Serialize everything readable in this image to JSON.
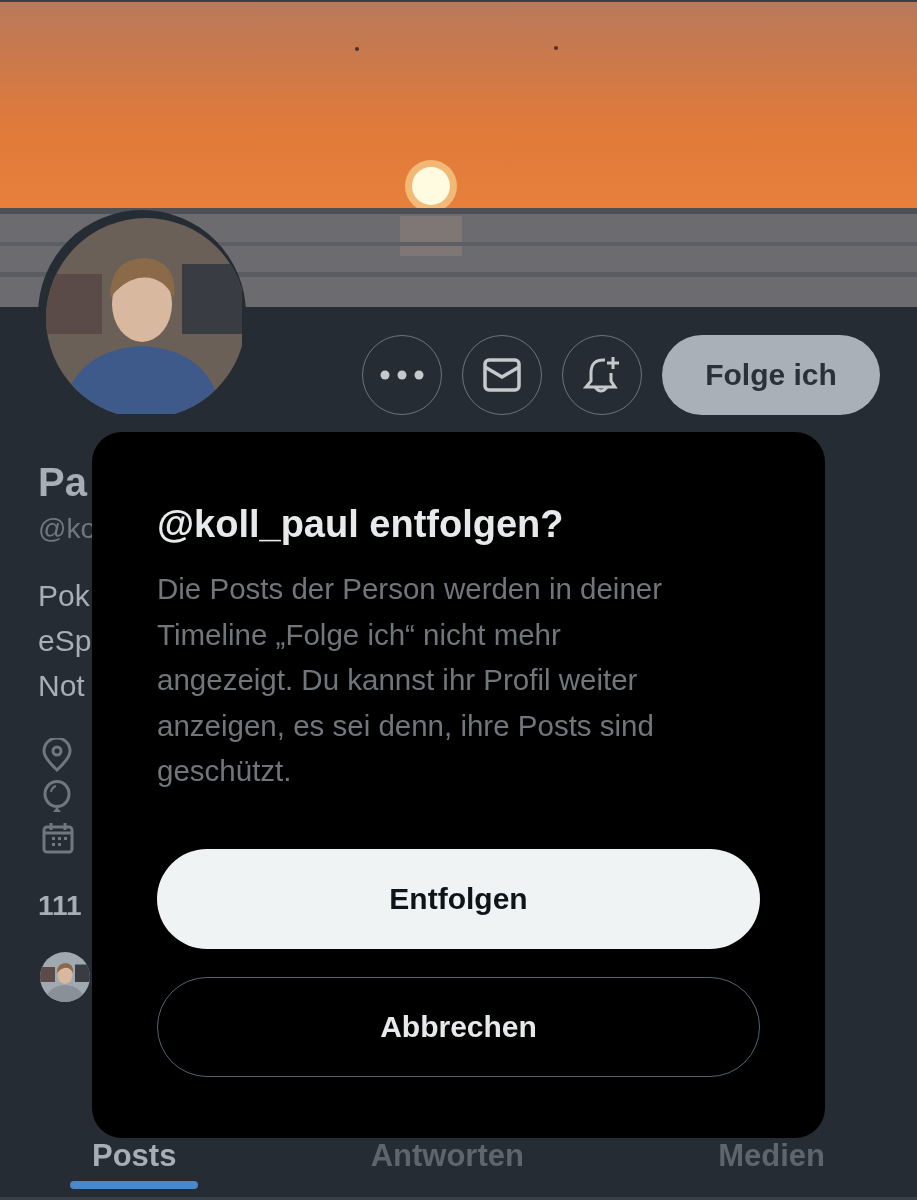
{
  "follow_button": {
    "label": "Folge ich"
  },
  "profile": {
    "name": "Pa",
    "handle": "@ko",
    "bio": [
      "Pok",
      "eSp",
      "Not"
    ],
    "stats": "111"
  },
  "tabs": [
    {
      "label": "Posts",
      "selected": true
    },
    {
      "label": "Antworten",
      "selected": false
    },
    {
      "label": "Medien",
      "selected": false
    }
  ],
  "dialog": {
    "title": "@koll_paul entfolgen?",
    "body": "Die Posts der Person werden in deiner Timeline „Folge ich“ nicht mehr angezeigt. Du kannst ihr Profil weiter anzeigen, es sei denn, ihre Posts sind geschützt.",
    "confirm": "Entfolgen",
    "cancel": "Abbrechen"
  }
}
